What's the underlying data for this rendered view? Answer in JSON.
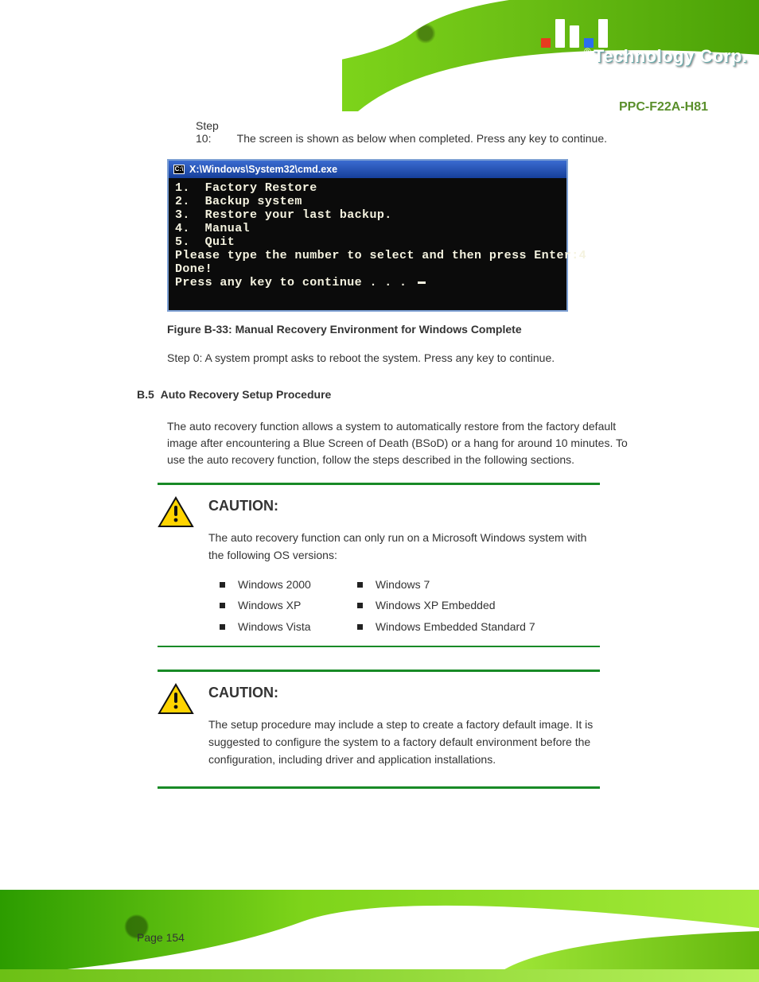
{
  "brand": {
    "reg": "®",
    "name": "Technology Corp."
  },
  "header_model": "PPC-F22A-H81",
  "steps": {
    "s10": {
      "num": "Step 10:",
      "text": "The screen is shown as below when completed. Press any key to continue."
    },
    "s11": {
      "num": "Step 0:"
    }
  },
  "cmd": {
    "title_path": "X:\\Windows\\System32\\cmd.exe",
    "lines": [
      "1.  Factory Restore",
      "2.  Backup system",
      "3.  Restore your last backup.",
      "4.  Manual",
      "5.  Quit",
      "Please type the number to select and then press Enter:4",
      "",
      "Done!",
      "Press any key to continue . . . "
    ]
  },
  "figure_caption": "Figure B-33: Manual Recovery Environment for Windows Complete",
  "step11_text": "Step 0: A system prompt asks to reboot the system. Press any key to continue.",
  "section": {
    "number": "B.5",
    "title": "Auto Recovery Setup Procedure",
    "desc": "The auto recovery function allows a system to automatically restore from the factory default image after encountering a Blue Screen of Death (BSoD) or a hang for around 10 minutes. To use the auto recovery function, follow the steps described in the following sections."
  },
  "caution1": {
    "label": "CAUTION:",
    "text": "The auto recovery function can only run on a Microsoft Windows system with the following OS versions:",
    "left": [
      "Windows 2000",
      "Windows XP",
      "Windows Vista"
    ],
    "right": [
      "Windows 7",
      "Windows XP Embedded",
      "Windows Embedded Standard 7"
    ]
  },
  "caution2": {
    "label": "CAUTION:",
    "text": "The setup procedure may include a step to create a factory default image. It is suggested to configure the system to a factory default environment before the configuration, including driver and application installations."
  },
  "page_label": "Page 154",
  "page_num": "154"
}
